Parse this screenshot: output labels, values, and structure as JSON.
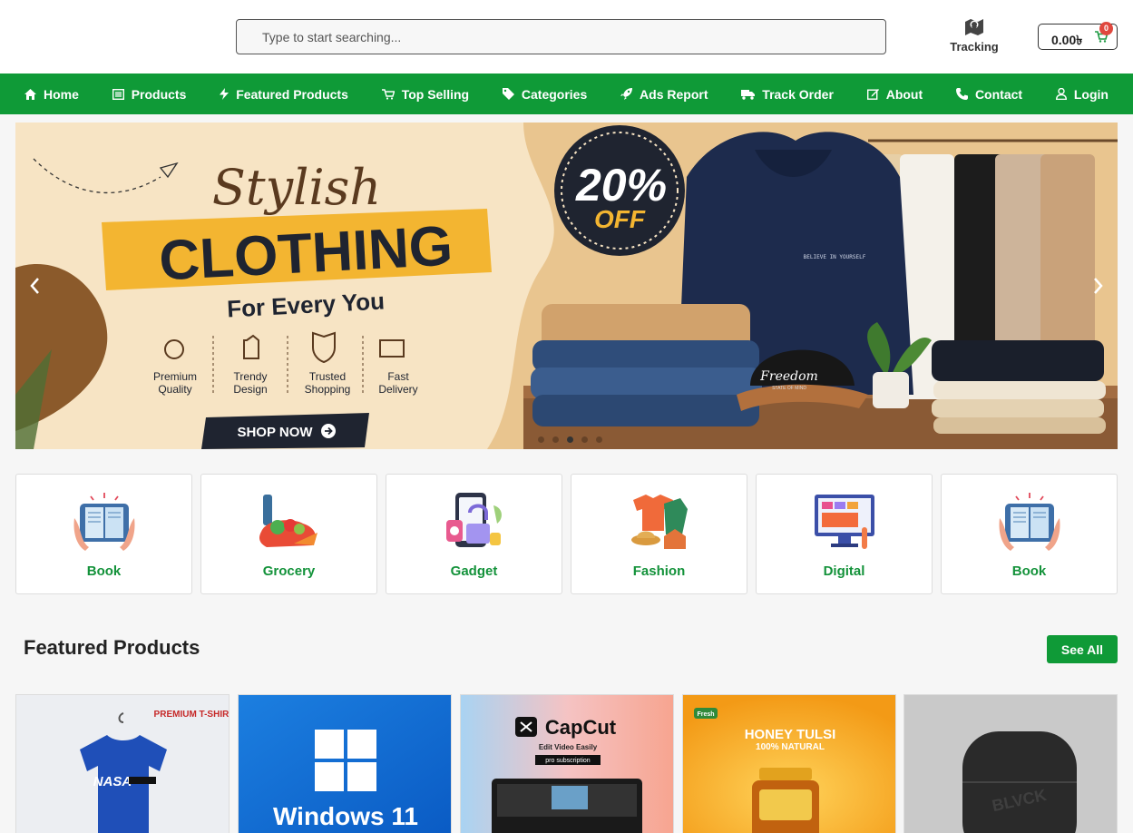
{
  "header": {
    "search_placeholder": "Type to start searching...",
    "tracking_label": "Tracking",
    "tracking_icon": "map-pin-icon",
    "cart_total": "0.00৳",
    "cart_count": "0"
  },
  "nav": {
    "items": [
      {
        "label": "Home",
        "icon": "home-icon"
      },
      {
        "label": "Products",
        "icon": "list-icon"
      },
      {
        "label": "Featured Products",
        "icon": "bolt-icon"
      },
      {
        "label": "Top Selling",
        "icon": "cart-icon"
      },
      {
        "label": "Categories",
        "icon": "tag-icon"
      },
      {
        "label": "Ads Report",
        "icon": "rocket-icon"
      },
      {
        "label": "Track Order",
        "icon": "truck-icon"
      },
      {
        "label": "About",
        "icon": "edit-icon"
      },
      {
        "label": "Contact",
        "icon": "phone-icon"
      },
      {
        "label": "Login",
        "icon": "user-icon"
      }
    ]
  },
  "hero": {
    "script_title": "Stylish",
    "headline": "CLOTHING",
    "subheadline": "For Every You",
    "discount_value": "20%",
    "discount_word": "OFF",
    "features": [
      "Premium Quality",
      "Trendy Design",
      "Trusted Shopping",
      "Fast Delivery"
    ],
    "cta": "SHOP NOW",
    "hoodie_print": "BELIEVE IN YOURSELF",
    "cap_print": "Freedom",
    "cap_sub": "STATE OF MIND",
    "slide_count": 5,
    "active_slide": 3
  },
  "categories": [
    {
      "name": "Book"
    },
    {
      "name": "Grocery"
    },
    {
      "name": "Gadget"
    },
    {
      "name": "Fashion"
    },
    {
      "name": "Digital"
    },
    {
      "name": "Book"
    }
  ],
  "featured": {
    "title": "Featured Products",
    "see_all": "See All",
    "products": [
      {
        "tag": "PREMIUM T-SHIRT",
        "print": "NASA"
      },
      {
        "title": "Windows 11"
      },
      {
        "title": "CapCut",
        "sub": "Edit Video Easily",
        "badge": "pro subscription"
      },
      {
        "title": "HONEY TULSI",
        "sub": "100% NATURAL",
        "badge": "Fresh"
      },
      {
        "print": "BLVCK"
      }
    ]
  },
  "colors": {
    "brand_green": "#0f9a37",
    "category_text": "#13923a",
    "badge_red": "#e0483e",
    "hero_yellow": "#f3b531",
    "hero_dark": "#1f2430"
  }
}
